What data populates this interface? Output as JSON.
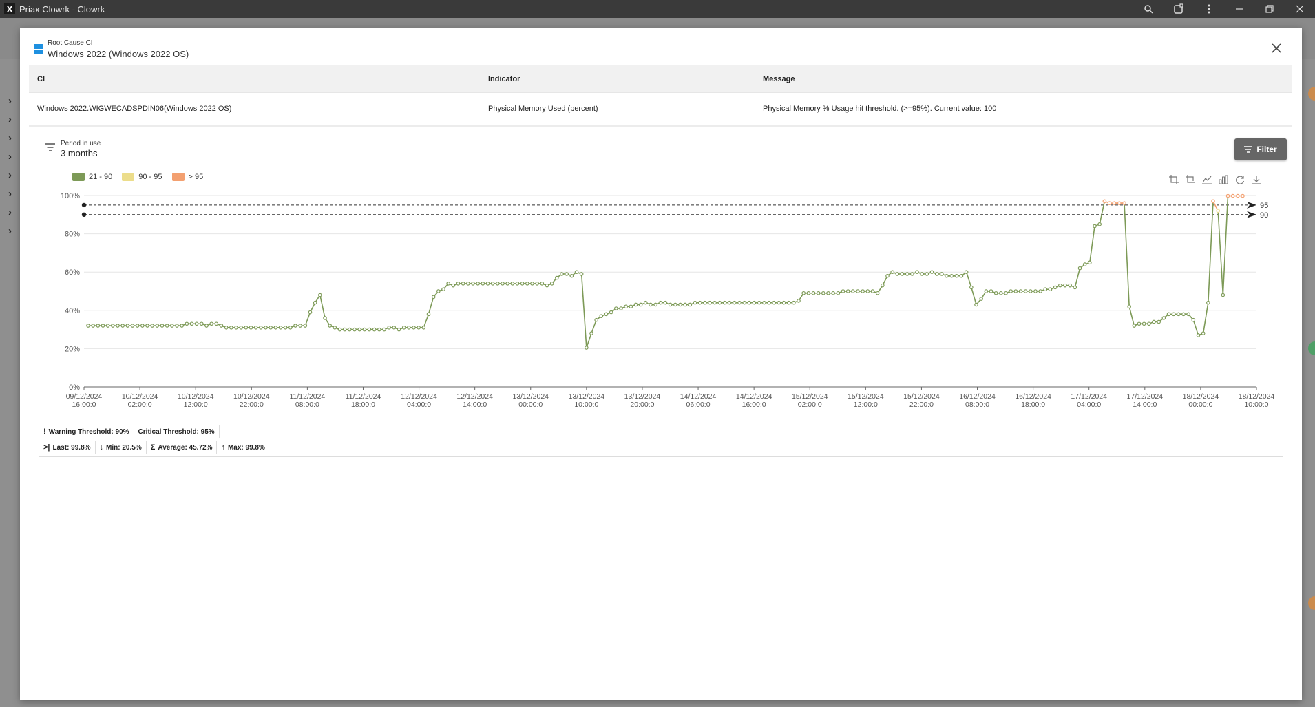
{
  "window": {
    "title": "Priax Clowrk - Clowrk",
    "app_icon": "X"
  },
  "modal": {
    "kicker": "Root Cause CI",
    "title": "Windows 2022 (Windows 2022 OS)",
    "table": {
      "headers": [
        "CI",
        "Indicator",
        "Message"
      ],
      "row": {
        "ci": "Windows 2022.WIGWECADSPDIN06(Windows 2022 OS)",
        "indicator": "Physical Memory Used (percent)",
        "message": "Physical Memory % Usage hit threshold. (>=95%). Current value: 100"
      }
    },
    "period": {
      "label": "Period in use",
      "value": "3 months"
    },
    "filter_button": "Filter",
    "stats": {
      "warning": "Warning Threshold: 90%",
      "critical": "Critical Threshold: 95%",
      "last": "Last: 99.8%",
      "min": "Min: 20.5%",
      "average": "Average: 45.72%",
      "max": "Max: 99.8%"
    }
  },
  "chart_data": {
    "type": "line",
    "legend": [
      {
        "label": "21 - 90",
        "color": "#7d9a57"
      },
      {
        "label": "90 - 95",
        "color": "#ecdd8b"
      },
      {
        "label": "> 95",
        "color": "#f3a070"
      }
    ],
    "y_ticks": [
      "0%",
      "20%",
      "40%",
      "60%",
      "80%",
      "100%"
    ],
    "ylim": [
      0,
      100
    ],
    "x_tick_labels": [
      [
        "09/12/2024",
        "16:00:0"
      ],
      [
        "10/12/2024",
        "02:00:0"
      ],
      [
        "10/12/2024",
        "12:00:0"
      ],
      [
        "10/12/2024",
        "22:00:0"
      ],
      [
        "11/12/2024",
        "08:00:0"
      ],
      [
        "11/12/2024",
        "18:00:0"
      ],
      [
        "12/12/2024",
        "04:00:0"
      ],
      [
        "12/12/2024",
        "14:00:0"
      ],
      [
        "13/12/2024",
        "00:00:0"
      ],
      [
        "13/12/2024",
        "10:00:0"
      ],
      [
        "13/12/2024",
        "20:00:0"
      ],
      [
        "14/12/2024",
        "06:00:0"
      ],
      [
        "14/12/2024",
        "16:00:0"
      ],
      [
        "15/12/2024",
        "02:00:0"
      ],
      [
        "15/12/2024",
        "12:00:0"
      ],
      [
        "15/12/2024",
        "22:00:0"
      ],
      [
        "16/12/2024",
        "08:00:0"
      ],
      [
        "16/12/2024",
        "18:00:0"
      ],
      [
        "17/12/2024",
        "04:00:0"
      ],
      [
        "17/12/2024",
        "14:00:0"
      ],
      [
        "18/12/2024",
        "00:00:0"
      ],
      [
        "18/12/2024",
        "10:00:0"
      ]
    ],
    "thresholds": [
      {
        "label": "95",
        "value": 95
      },
      {
        "label": "90",
        "value": 90
      }
    ],
    "series": [
      {
        "values": [
          32,
          32,
          32,
          32,
          32,
          32,
          32,
          32,
          32,
          32,
          32,
          32,
          32,
          32,
          32,
          32,
          32,
          32,
          32,
          32,
          33,
          33,
          33,
          33,
          32,
          33,
          33,
          32,
          31,
          31,
          31,
          31,
          31,
          31,
          31,
          31,
          31,
          31,
          31,
          31,
          31,
          31,
          32,
          32,
          32,
          39,
          44,
          48,
          36,
          32,
          31,
          30,
          30,
          30,
          30,
          30,
          30,
          30,
          30,
          30,
          30,
          31,
          31,
          30,
          31,
          31,
          31,
          31,
          31,
          38,
          47,
          50,
          51,
          54,
          53,
          54,
          54,
          54,
          54,
          54,
          54,
          54,
          54,
          54,
          54,
          54,
          54,
          54,
          54,
          54,
          54,
          54,
          54,
          53,
          54,
          57,
          59,
          59,
          58,
          60,
          59,
          20.5,
          28,
          35,
          37,
          38,
          39,
          41,
          41,
          42,
          42,
          43,
          43,
          44,
          43,
          43,
          44,
          44,
          43,
          43,
          43,
          43,
          43,
          44,
          44,
          44,
          44,
          44,
          44,
          44,
          44,
          44,
          44,
          44,
          44,
          44,
          44,
          44,
          44,
          44,
          44,
          44,
          44,
          44,
          45,
          49,
          49,
          49,
          49,
          49,
          49,
          49,
          49,
          50,
          50,
          50,
          50,
          50,
          50,
          50,
          49,
          53,
          58,
          60,
          59,
          59,
          59,
          59,
          60,
          59,
          59,
          60,
          59,
          59,
          58,
          58,
          58,
          58,
          60,
          52,
          43,
          46,
          50,
          50,
          49,
          49,
          49,
          50,
          50,
          50,
          50,
          50,
          50,
          50,
          51,
          51,
          52,
          53,
          53,
          53,
          52,
          62,
          64,
          65,
          84,
          85,
          97,
          96,
          96,
          96,
          96,
          42,
          32,
          33,
          33,
          33,
          34,
          34,
          36,
          38,
          38,
          38,
          38,
          38,
          35,
          27,
          28,
          44,
          97,
          92,
          48,
          99.8,
          99.8,
          99.8,
          99.8
        ]
      }
    ]
  }
}
